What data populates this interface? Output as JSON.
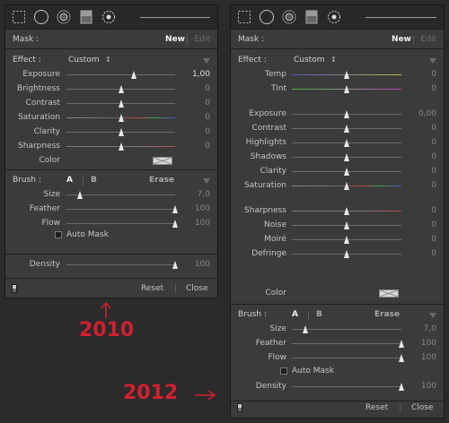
{
  "panels": {
    "old": {
      "mask": {
        "label": "Mask :",
        "new": "New",
        "edit": "Edit"
      },
      "effect": {
        "label": "Effect :",
        "preset": "Custom",
        "arrows": "↕"
      },
      "sliders": [
        {
          "label": "Exposure",
          "value": "1,00",
          "bright": true,
          "pos": 0.62,
          "track": "plain"
        },
        {
          "label": "Brightness",
          "value": "0",
          "pos": 0.5,
          "track": "plain"
        },
        {
          "label": "Contrast",
          "value": "0",
          "pos": 0.5,
          "track": "plain"
        },
        {
          "label": "Saturation",
          "value": "0",
          "pos": 0.5,
          "track": "sat"
        },
        {
          "label": "Clarity",
          "value": "0",
          "pos": 0.5,
          "track": "plain"
        },
        {
          "label": "Sharpness",
          "value": "0",
          "pos": 0.5,
          "track": "sharp"
        }
      ],
      "color_label": "Color",
      "brush": {
        "label": "Brush :",
        "a": "A",
        "b": "B",
        "erase": "Erase"
      },
      "brush_sliders": [
        {
          "label": "Size",
          "value": "7,0",
          "pos": 0.12
        },
        {
          "label": "Feather",
          "value": "100",
          "pos": 1.0
        },
        {
          "label": "Flow",
          "value": "100",
          "pos": 1.0
        }
      ],
      "auto_mask": "Auto Mask",
      "density": {
        "label": "Density",
        "value": "100",
        "pos": 1.0
      },
      "footer": {
        "reset": "Reset",
        "close": "Close"
      }
    },
    "new": {
      "mask": {
        "label": "Mask :",
        "new": "New",
        "edit": "Edit"
      },
      "effect": {
        "label": "Effect :",
        "preset": "Custom",
        "arrows": "↕"
      },
      "groups": [
        [
          {
            "label": "Temp",
            "value": "0",
            "pos": 0.5,
            "track": "temp"
          },
          {
            "label": "Tint",
            "value": "0",
            "pos": 0.5,
            "track": "tint"
          }
        ],
        [
          {
            "label": "Exposure",
            "value": "0,00",
            "pos": 0.5,
            "track": "plain"
          },
          {
            "label": "Contrast",
            "value": "0",
            "pos": 0.5,
            "track": "plain"
          },
          {
            "label": "Highlights",
            "value": "0",
            "pos": 0.5,
            "track": "plain"
          },
          {
            "label": "Shadows",
            "value": "0",
            "pos": 0.5,
            "track": "plain"
          },
          {
            "label": "Clarity",
            "value": "0",
            "pos": 0.5,
            "track": "plain"
          },
          {
            "label": "Saturation",
            "value": "0",
            "pos": 0.5,
            "track": "sat"
          }
        ],
        [
          {
            "label": "Sharpness",
            "value": "0",
            "pos": 0.5,
            "track": "sharp"
          },
          {
            "label": "Noise",
            "value": "0",
            "pos": 0.5,
            "track": "plain"
          },
          {
            "label": "Moiré",
            "value": "0",
            "pos": 0.5,
            "track": "plain"
          },
          {
            "label": "Defringe",
            "value": "0",
            "pos": 0.5,
            "track": "plain"
          }
        ]
      ],
      "color_label": "Color",
      "brush": {
        "label": "Brush :",
        "a": "A",
        "b": "B",
        "erase": "Erase"
      },
      "brush_sliders": [
        {
          "label": "Size",
          "value": "7,0",
          "pos": 0.12
        },
        {
          "label": "Feather",
          "value": "100",
          "pos": 1.0
        },
        {
          "label": "Flow",
          "value": "100",
          "pos": 1.0
        }
      ],
      "auto_mask": "Auto Mask",
      "density": {
        "label": "Density",
        "value": "100",
        "pos": 1.0
      },
      "footer": {
        "reset": "Reset",
        "close": "Close"
      }
    }
  },
  "annotations": {
    "year_old": "2010",
    "year_new": "2012",
    "color": "#d21f2f"
  },
  "icons": [
    "marquee-icon",
    "circle-icon",
    "radial-filter-icon",
    "gradient-filter-icon",
    "brush-icon"
  ]
}
